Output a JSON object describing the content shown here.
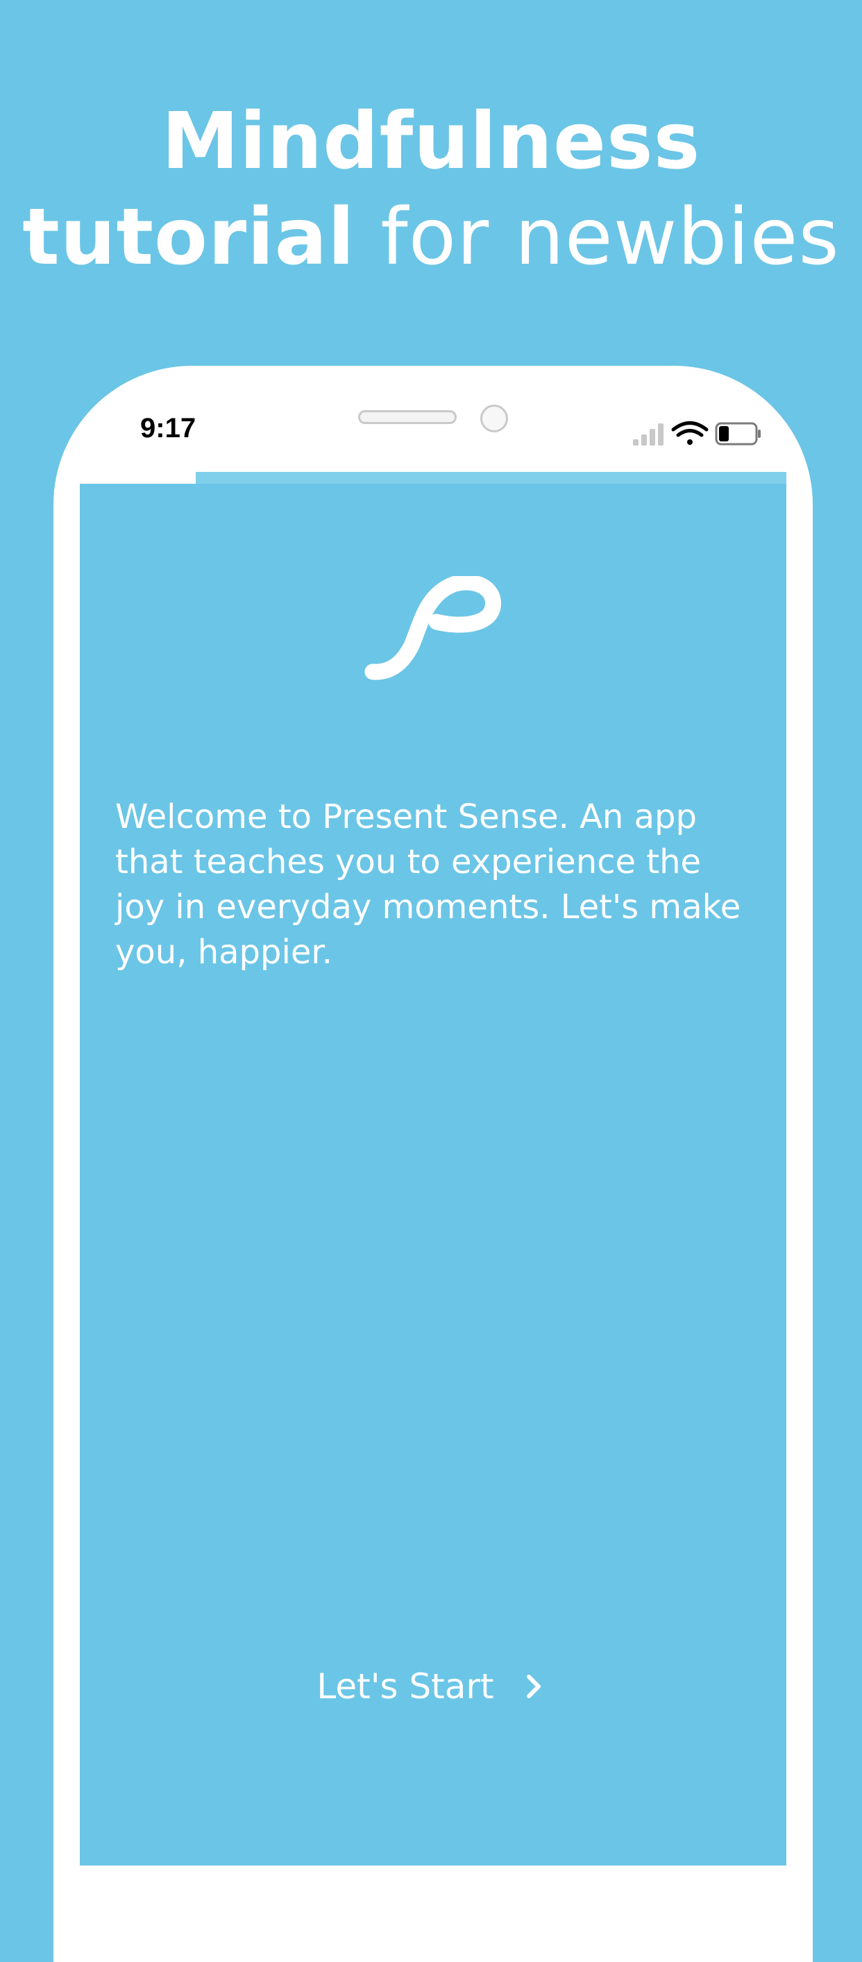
{
  "header": {
    "line1": "Mindfulness",
    "line2_bold": "tutorial",
    "line2_light": " for newbies"
  },
  "phone": {
    "status_bar": {
      "time": "9:17",
      "icons": [
        "cellular-signal-icon",
        "wifi-icon",
        "battery-icon"
      ]
    },
    "progress": {
      "completed_fraction": 0.16
    },
    "screen": {
      "logo": "present-sense-logo",
      "welcome_text": "Welcome to Present Sense. An app that teaches you to experience the joy in everyday moments. Let's make you, happier.",
      "cta_label": "Let's Start",
      "cta_icon": "chevron-right-icon"
    }
  },
  "colors": {
    "background": "#6bc5e6",
    "phone_frame": "#ffffff",
    "text": "#ffffff"
  }
}
